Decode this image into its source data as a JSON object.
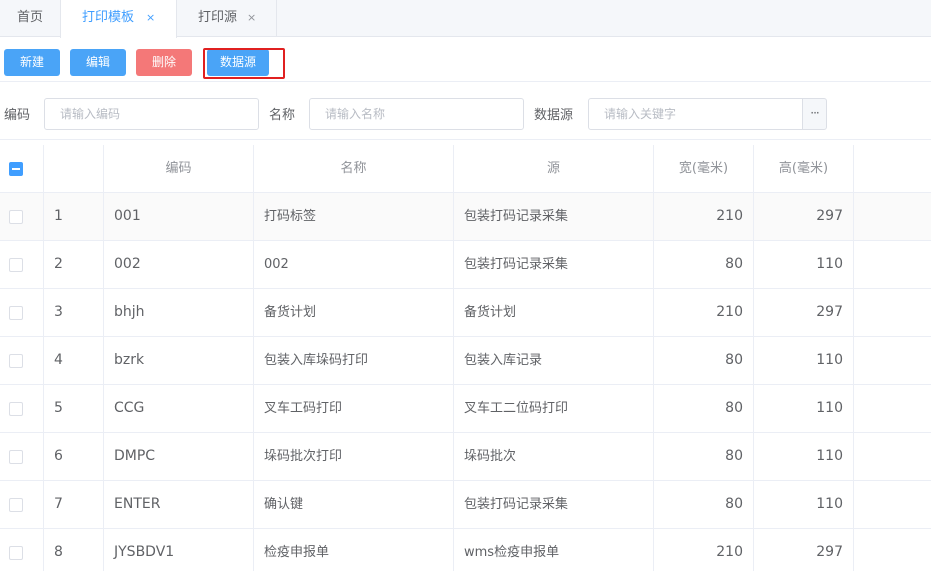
{
  "tabs": [
    {
      "label": "首页"
    },
    {
      "label": "打印模板",
      "close": "×"
    },
    {
      "label": "打印源",
      "close": "×"
    }
  ],
  "toolbar": {
    "new_label": "新建",
    "edit_label": "编辑",
    "delete_label": "删除",
    "datasource_label": "数据源"
  },
  "search": {
    "code_label": "编码",
    "code_placeholder": "请输入编码",
    "name_label": "名称",
    "name_placeholder": "请输入名称",
    "source_label": "数据源",
    "source_placeholder": "请输入关键字",
    "more_glyph": "···"
  },
  "table": {
    "headers": {
      "code": "编码",
      "name": "名称",
      "source": "源",
      "width": "宽(毫米)",
      "height": "高(毫米)"
    },
    "rows": [
      {
        "idx": "1",
        "code": "001",
        "name": "打码标签",
        "source": "包装打码记录采集",
        "width": "210",
        "height": "297"
      },
      {
        "idx": "2",
        "code": "002",
        "name": "002",
        "source": "包装打码记录采集",
        "width": "80",
        "height": "110"
      },
      {
        "idx": "3",
        "code": "bhjh",
        "name": "备货计划",
        "source": "备货计划",
        "width": "210",
        "height": "297"
      },
      {
        "idx": "4",
        "code": "bzrk",
        "name": "包装入库垛码打印",
        "source": "包装入库记录",
        "width": "80",
        "height": "110"
      },
      {
        "idx": "5",
        "code": "CCG",
        "name": "叉车工码打印",
        "source": "叉车工二位码打印",
        "width": "80",
        "height": "110"
      },
      {
        "idx": "6",
        "code": "DMPC",
        "name": "垛码批次打印",
        "source": "垛码批次",
        "width": "80",
        "height": "110"
      },
      {
        "idx": "7",
        "code": "ENTER",
        "name": "确认键",
        "source": "包装打码记录采集",
        "width": "80",
        "height": "110"
      },
      {
        "idx": "8",
        "code": "JYSBDV1",
        "name": "检疫申报单",
        "source": "wms检疫申报单",
        "width": "210",
        "height": "297"
      }
    ]
  },
  "colors": {
    "primary": "#409eff",
    "button_blue": "#4aa4f7",
    "danger": "#f47878",
    "highlight_border": "#e02020"
  }
}
